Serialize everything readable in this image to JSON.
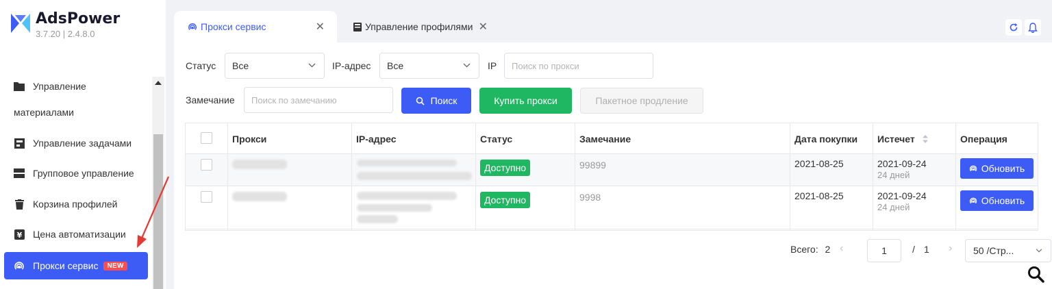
{
  "app": {
    "name": "AdsPower",
    "version": "3.7.20  |  2.4.8.0"
  },
  "sidebar": {
    "items": [
      {
        "label": "Управление",
        "label_cont": "материалами",
        "icon": "folder-icon"
      },
      {
        "label": "Управление задачами",
        "icon": "task-icon"
      },
      {
        "label": "Групповое управление",
        "icon": "group-icon"
      },
      {
        "label": "Корзина профилей",
        "icon": "trash-icon"
      },
      {
        "label": "Цена автоматизации",
        "icon": "price-icon"
      },
      {
        "label": "Прокси сервис",
        "icon": "proxy-icon",
        "badge": "NEW",
        "active": true
      }
    ]
  },
  "tabs": [
    {
      "label": "Прокси сервис",
      "icon": "proxy-icon",
      "active": true
    },
    {
      "label": "Управление профилями",
      "icon": "profile-icon",
      "active": false
    }
  ],
  "filters": {
    "status_label": "Статус",
    "status_value": "Все",
    "ip_label": "IP-адрес",
    "ip_value": "Все",
    "ip_search_label": "IP",
    "ip_search_placeholder": "Поиск по прокси",
    "remark_label": "Замечание",
    "remark_placeholder": "Поиск по замечанию",
    "search_button": "Поиск",
    "buy_button": "Купить прокси",
    "batch_button": "Пакетное продление"
  },
  "table": {
    "columns": [
      "Прокси",
      "IP-адрес",
      "Статус",
      "Замечание",
      "Дата покупки",
      "Истечет",
      "Операция"
    ],
    "rows": [
      {
        "status": "Доступно",
        "remark": "99899",
        "purchase_date": "2021-08-25",
        "expires": "2021-09-24",
        "days_left": "24 дней",
        "action": "Обновить"
      },
      {
        "status": "Доступно",
        "remark": "9998",
        "purchase_date": "2021-08-25",
        "expires": "2021-09-24",
        "days_left": "24 дней",
        "action": "Обновить"
      }
    ]
  },
  "pagination": {
    "total_label": "Всего:",
    "total_value": "2",
    "current_page": "1",
    "separator": "/",
    "page_count": "1",
    "page_size": "50 /Стр..."
  },
  "colors": {
    "primary": "#3d5cf5",
    "success": "#20b762",
    "badge": "#ff4d4f"
  }
}
